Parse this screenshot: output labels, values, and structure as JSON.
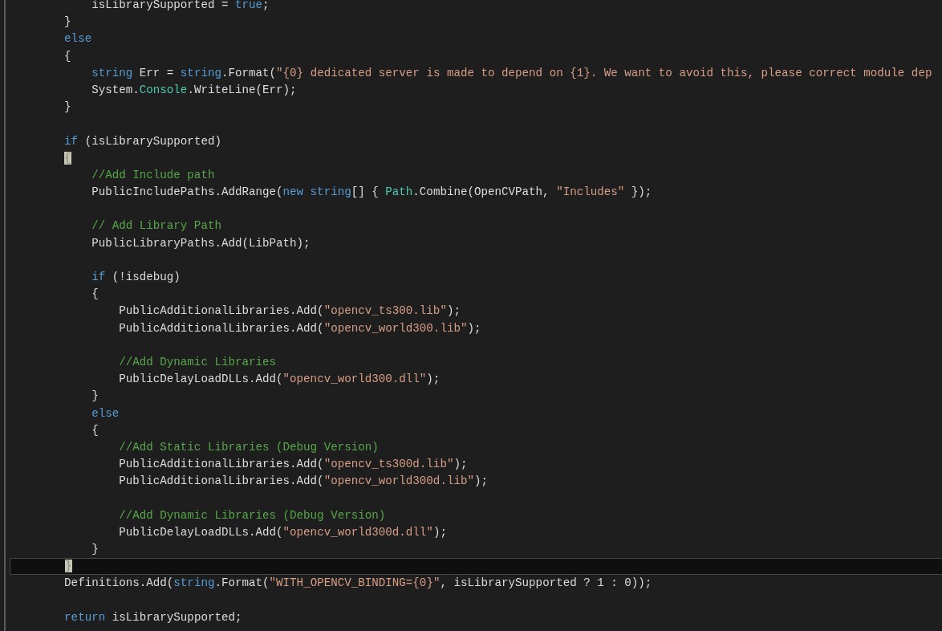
{
  "editor": {
    "lines": [
      {
        "kind": "group",
        "children": [
          {
            "kind": "code",
            "current": false,
            "brace_match": false,
            "tokens": [
              {
                "kind": "plain",
                "text": "isLibrarySupported = "
              },
              {
                "kind": "keyword",
                "text": "true"
              },
              {
                "kind": "plain",
                "text": ";"
              }
            ]
          }
        ]
      },
      {
        "kind": "code",
        "current": false,
        "brace_match": false,
        "tokens": [
          {
            "kind": "plain",
            "text": "}"
          }
        ]
      },
      {
        "kind": "code",
        "current": false,
        "brace_match": false,
        "tokens": [
          {
            "kind": "keyword",
            "text": "else"
          }
        ]
      },
      {
        "kind": "code",
        "current": false,
        "brace_match": false,
        "tokens": [
          {
            "kind": "plain",
            "text": "{"
          }
        ]
      },
      {
        "kind": "group",
        "children": [
          {
            "kind": "code",
            "current": false,
            "brace_match": false,
            "tokens": [
              {
                "kind": "keyword",
                "text": "string"
              },
              {
                "kind": "plain",
                "text": " Err = "
              },
              {
                "kind": "keyword",
                "text": "string"
              },
              {
                "kind": "plain",
                "text": ".Format("
              },
              {
                "kind": "string",
                "text": "\"{0} dedicated server is made to depend on {1}. We want to avoid this, please correct module dep"
              }
            ]
          },
          {
            "kind": "code",
            "current": false,
            "brace_match": false,
            "tokens": [
              {
                "kind": "plain",
                "text": "System."
              },
              {
                "kind": "type",
                "text": "Console"
              },
              {
                "kind": "plain",
                "text": ".WriteLine(Err);"
              }
            ]
          }
        ]
      },
      {
        "kind": "code",
        "current": false,
        "brace_match": false,
        "tokens": [
          {
            "kind": "plain",
            "text": "}"
          }
        ]
      },
      {
        "kind": "blank"
      },
      {
        "kind": "code",
        "current": false,
        "brace_match": false,
        "tokens": [
          {
            "kind": "keyword",
            "text": "if"
          },
          {
            "kind": "plain",
            "text": " (isLibrarySupported)"
          }
        ]
      },
      {
        "kind": "code",
        "current": false,
        "brace_match": true,
        "tokens": [
          {
            "kind": "plain",
            "text": "{"
          }
        ]
      },
      {
        "kind": "group",
        "children": [
          {
            "kind": "code",
            "current": false,
            "brace_match": false,
            "tokens": [
              {
                "kind": "comment",
                "text": "//Add Include path"
              }
            ]
          },
          {
            "kind": "code",
            "current": false,
            "brace_match": false,
            "tokens": [
              {
                "kind": "plain",
                "text": "PublicIncludePaths.AddRange("
              },
              {
                "kind": "keyword",
                "text": "new"
              },
              {
                "kind": "keyword",
                "text": " string"
              },
              {
                "kind": "plain",
                "text": "[] { "
              },
              {
                "kind": "type",
                "text": "Path"
              },
              {
                "kind": "plain",
                "text": ".Combine(OpenCVPath, "
              },
              {
                "kind": "string",
                "text": "\"Includes\""
              },
              {
                "kind": "plain",
                "text": " });"
              }
            ]
          },
          {
            "kind": "blank"
          },
          {
            "kind": "code",
            "current": false,
            "brace_match": false,
            "tokens": [
              {
                "kind": "comment",
                "text": "// Add Library Path"
              }
            ]
          },
          {
            "kind": "code",
            "current": false,
            "brace_match": false,
            "tokens": [
              {
                "kind": "plain",
                "text": "PublicLibraryPaths.Add(LibPath);"
              }
            ]
          },
          {
            "kind": "blank"
          },
          {
            "kind": "code",
            "current": false,
            "brace_match": false,
            "tokens": [
              {
                "kind": "keyword",
                "text": "if"
              },
              {
                "kind": "plain",
                "text": " (!isdebug)"
              }
            ]
          },
          {
            "kind": "code",
            "current": false,
            "brace_match": false,
            "tokens": [
              {
                "kind": "plain",
                "text": "{"
              }
            ]
          },
          {
            "kind": "group",
            "children": [
              {
                "kind": "code",
                "current": false,
                "brace_match": false,
                "tokens": [
                  {
                    "kind": "plain",
                    "text": "PublicAdditionalLibraries.Add("
                  },
                  {
                    "kind": "string",
                    "text": "\"opencv_ts300.lib\""
                  },
                  {
                    "kind": "plain",
                    "text": ");"
                  }
                ]
              },
              {
                "kind": "code",
                "current": false,
                "brace_match": false,
                "tokens": [
                  {
                    "kind": "plain",
                    "text": "PublicAdditionalLibraries.Add("
                  },
                  {
                    "kind": "string",
                    "text": "\"opencv_world300.lib\""
                  },
                  {
                    "kind": "plain",
                    "text": ");"
                  }
                ]
              },
              {
                "kind": "blank"
              },
              {
                "kind": "code",
                "current": false,
                "brace_match": false,
                "tokens": [
                  {
                    "kind": "comment",
                    "text": "//Add Dynamic Libraries"
                  }
                ]
              },
              {
                "kind": "code",
                "current": false,
                "brace_match": false,
                "tokens": [
                  {
                    "kind": "plain",
                    "text": "PublicDelayLoadDLLs.Add("
                  },
                  {
                    "kind": "string",
                    "text": "\"opencv_world300.dll\""
                  },
                  {
                    "kind": "plain",
                    "text": ");"
                  }
                ]
              }
            ]
          },
          {
            "kind": "code",
            "current": false,
            "brace_match": false,
            "tokens": [
              {
                "kind": "plain",
                "text": "}"
              }
            ]
          },
          {
            "kind": "code",
            "current": false,
            "brace_match": false,
            "tokens": [
              {
                "kind": "keyword",
                "text": "else"
              }
            ]
          },
          {
            "kind": "code",
            "current": false,
            "brace_match": false,
            "tokens": [
              {
                "kind": "plain",
                "text": "{"
              }
            ]
          },
          {
            "kind": "group",
            "children": [
              {
                "kind": "code",
                "current": false,
                "brace_match": false,
                "tokens": [
                  {
                    "kind": "comment",
                    "text": "//Add Static Libraries (Debug Version)"
                  }
                ]
              },
              {
                "kind": "code",
                "current": false,
                "brace_match": false,
                "tokens": [
                  {
                    "kind": "plain",
                    "text": "PublicAdditionalLibraries.Add("
                  },
                  {
                    "kind": "string",
                    "text": "\"opencv_ts300d.lib\""
                  },
                  {
                    "kind": "plain",
                    "text": ");"
                  }
                ]
              },
              {
                "kind": "code",
                "current": false,
                "brace_match": false,
                "tokens": [
                  {
                    "kind": "plain",
                    "text": "PublicAdditionalLibraries.Add("
                  },
                  {
                    "kind": "string",
                    "text": "\"opencv_world300d.lib\""
                  },
                  {
                    "kind": "plain",
                    "text": ");"
                  }
                ]
              },
              {
                "kind": "blank"
              },
              {
                "kind": "code",
                "current": false,
                "brace_match": false,
                "tokens": [
                  {
                    "kind": "comment",
                    "text": "//Add Dynamic Libraries (Debug Version)"
                  }
                ]
              },
              {
                "kind": "code",
                "current": false,
                "brace_match": false,
                "tokens": [
                  {
                    "kind": "plain",
                    "text": "PublicDelayLoadDLLs.Add("
                  },
                  {
                    "kind": "string",
                    "text": "\"opencv_world300d.dll\""
                  },
                  {
                    "kind": "plain",
                    "text": ");"
                  }
                ]
              }
            ]
          },
          {
            "kind": "code",
            "current": false,
            "brace_match": false,
            "tokens": [
              {
                "kind": "plain",
                "text": "}"
              }
            ]
          }
        ]
      },
      {
        "kind": "code",
        "current": true,
        "brace_match": true,
        "tokens": [
          {
            "kind": "plain",
            "text": "}"
          }
        ]
      },
      {
        "kind": "code",
        "current": false,
        "brace_match": false,
        "tokens": [
          {
            "kind": "plain",
            "text": "Definitions.Add("
          },
          {
            "kind": "keyword",
            "text": "string"
          },
          {
            "kind": "plain",
            "text": ".Format("
          },
          {
            "kind": "string",
            "text": "\"WITH_OPENCV_BINDING={0}\""
          },
          {
            "kind": "plain",
            "text": ", isLibrarySupported ? 1 : 0));"
          }
        ]
      },
      {
        "kind": "blank"
      },
      {
        "kind": "code",
        "current": false,
        "brace_match": false,
        "tokens": [
          {
            "kind": "keyword",
            "text": "return"
          },
          {
            "kind": "plain",
            "text": " isLibrarySupported;"
          }
        ]
      }
    ]
  }
}
